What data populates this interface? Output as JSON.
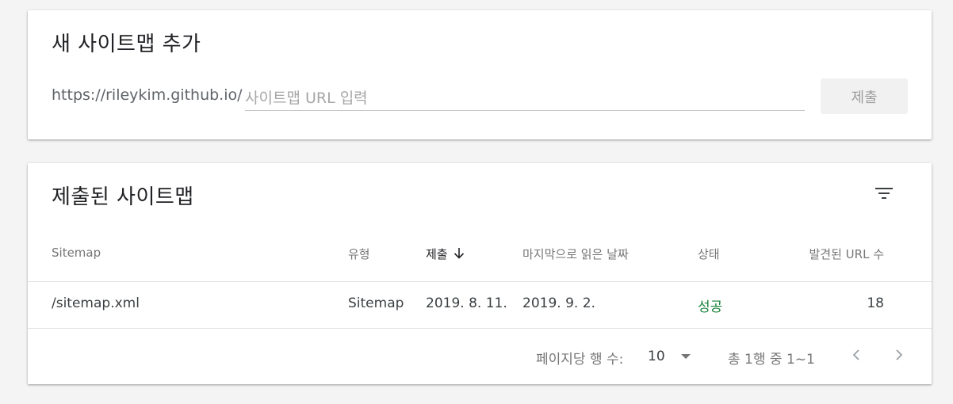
{
  "add_sitemap": {
    "title": "새 사이트맵 추가",
    "url_prefix": "https://rileykim.github.io/",
    "input_value": "",
    "input_placeholder": "사이트맵 URL 입력",
    "submit_label": "제출"
  },
  "submitted_sitemaps": {
    "title": "제출된 사이트맵",
    "filter_icon": "filter-icon",
    "columns": [
      "Sitemap",
      "유형",
      "제출",
      "마지막으로 읽은 날짜",
      "상태",
      "발견된 URL 수"
    ],
    "sorted_column": "제출",
    "sort_direction": "descending",
    "rows": [
      {
        "sitemap": "/sitemap.xml",
        "type": "Sitemap",
        "submitted": "2019. 8. 11.",
        "last_read": "2019. 9. 2.",
        "status": "성공",
        "discovered_urls": "18"
      }
    ],
    "status_color": "#188038",
    "pagination": {
      "rows_per_page_label": "페이지당 행 수:",
      "rows_per_page_value": "10",
      "range_label": "총 1행 중 1~1",
      "prev_icon": "chevron-left-icon",
      "next_icon": "chevron-right-icon"
    }
  }
}
